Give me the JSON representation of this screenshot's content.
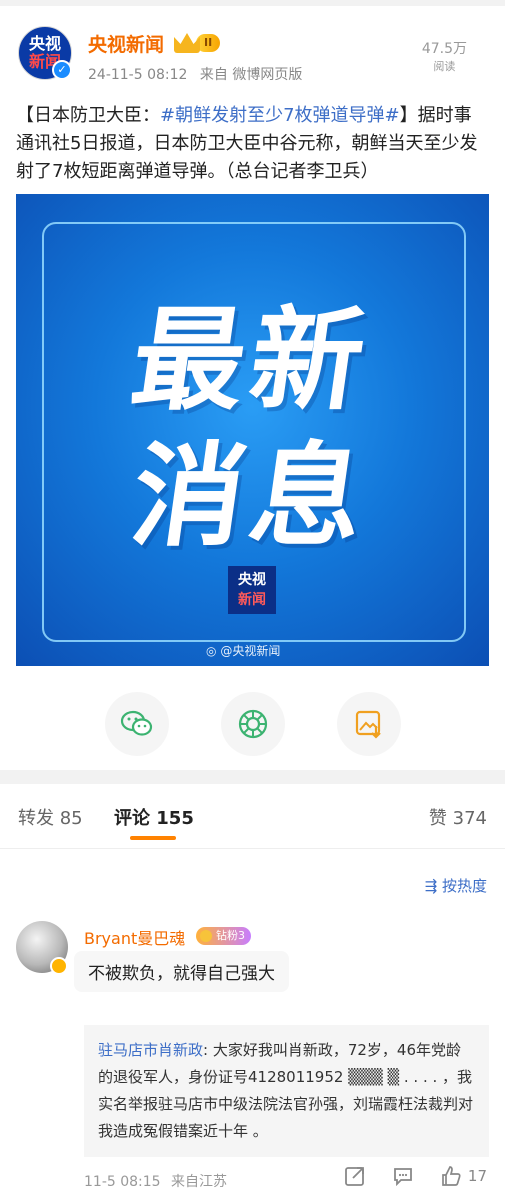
{
  "post": {
    "author": "央视新闻",
    "level_badge": "II",
    "timestamp": "24-11-5 08:12",
    "source": "来自 微博网页版",
    "views_count": "47.5万",
    "views_label": "阅读",
    "text_prefix": "【日本防卫大臣：",
    "hashtag": "#朝鲜发射至少7枚弹道导弹#",
    "text_body": "】据时事通讯社5日报道，日本防卫大臣中谷元称，朝鲜当天至少发射了7枚短距离弹道导弹。（总台记者李卫兵）",
    "image": {
      "headline_line1": "最新",
      "headline_line2": "消息",
      "logo_line1": "央视",
      "logo_line2": "新闻",
      "watermark": "@央视新闻"
    },
    "avatar_line1": "央视",
    "avatar_line2": "新闻"
  },
  "share_icons": [
    "wechat-icon",
    "moments-icon",
    "save-image-icon"
  ],
  "tabs": {
    "reposts_label": "转发",
    "reposts_count": "85",
    "comments_label": "评论",
    "comments_count": "155",
    "likes_label": "赞",
    "likes_count": "374"
  },
  "sort_label": "按热度",
  "comment": {
    "user": "Bryant曼巴魂",
    "fan_badge": "钻粉3",
    "text": "不被欺负，就得自己强大",
    "reply_user": "驻马店市肖新政",
    "reply_text": ": 大家好我叫肖新政，72岁，46年党龄的退役军人，身份证号4128011952 ▒▒▒ ▒ . . . . ，我实名举报驻马店市中级法院法官孙强，刘瑞霞枉法裁判对我造成冤假错案近十年 。",
    "time": "11-5 08:15",
    "location": "来自江苏",
    "likes": "17"
  },
  "colors": {
    "accent_orange": "#f36b00",
    "link_blue": "#3d6ec7",
    "tab_indicator": "#ff8200",
    "image_blue": "#1378da"
  }
}
